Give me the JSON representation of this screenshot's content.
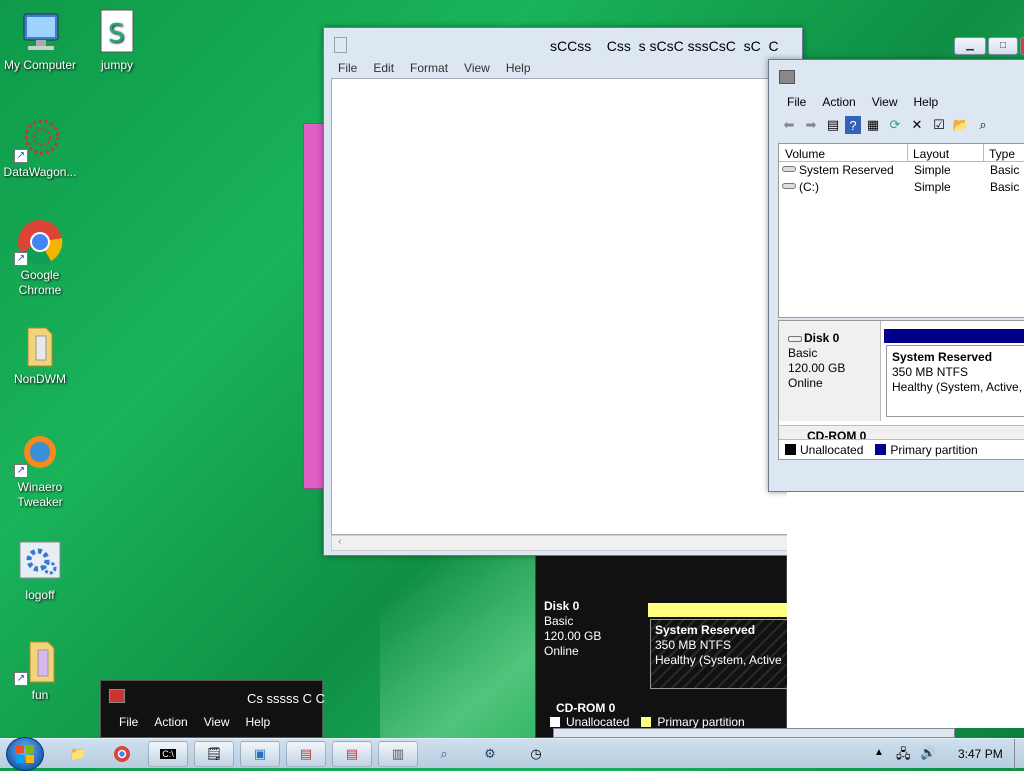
{
  "desktop_icons": [
    {
      "label": "My Computer"
    },
    {
      "label": "jumpy"
    },
    {
      "label": "DataWagon..."
    },
    {
      "label": "Google Chrome"
    },
    {
      "label": "NonDWM"
    },
    {
      "label": "Winaero Tweaker"
    },
    {
      "label": "logoff"
    },
    {
      "label": "fun"
    }
  ],
  "notepad": {
    "title": "sCCss    Css  s sCsC sssCsC  sC  C",
    "menu": [
      "File",
      "Edit",
      "Format",
      "View",
      "Help"
    ]
  },
  "diskmgmt": {
    "menu": [
      "File",
      "Action",
      "View",
      "Help"
    ],
    "columns": [
      "Volume",
      "Layout",
      "Type"
    ],
    "rows": [
      [
        "System Reserved",
        "Simple",
        "Basic"
      ],
      [
        "(C:)",
        "Simple",
        "Basic"
      ]
    ],
    "disk": {
      "name": "Disk 0",
      "type": "Basic",
      "size": "120.00 GB",
      "status": "Online"
    },
    "partition": {
      "name": "System Reserved",
      "fs": "350 MB NTFS",
      "health": "Healthy (System, Active, P"
    },
    "cdrom": "CD-ROM 0",
    "legend": [
      "Unallocated",
      "Primary partition"
    ]
  },
  "dark_disk": {
    "disk": {
      "name": "Disk 0",
      "type": "Basic",
      "size": "120.00 GB",
      "status": "Online"
    },
    "partition": {
      "name": "System Reserved",
      "fs": "350 MB NTFS",
      "health": "Healthy (System, Active, P"
    },
    "cdrom": "CD-ROM 0",
    "legend": [
      "Unallocated",
      "Primary partition"
    ]
  },
  "dark_mmc": {
    "title": "Cs sssss C C",
    "menu": [
      "File",
      "Action",
      "View",
      "Help"
    ]
  },
  "taskbar": {
    "clock": "3:47 PM"
  },
  "colors": {
    "primary_partition": "#00008b",
    "unallocated": "#000000",
    "desktop": "#13a551"
  }
}
